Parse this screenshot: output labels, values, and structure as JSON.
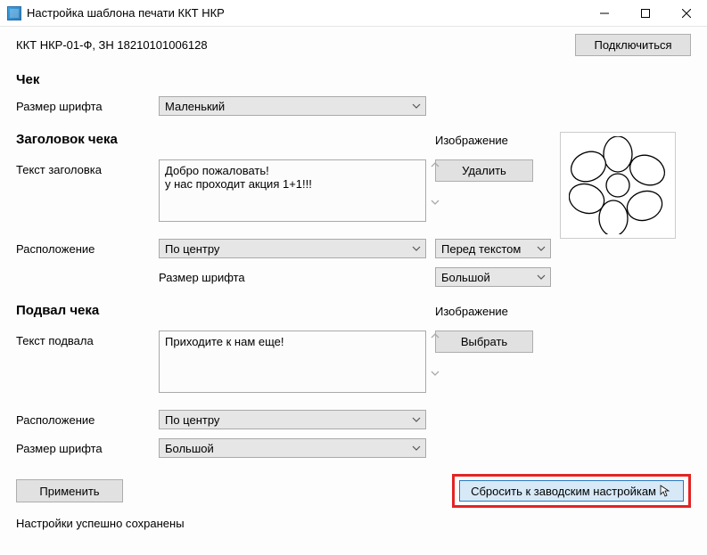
{
  "titlebar": {
    "title": "Настройка шаблона печати ККТ НКР"
  },
  "top": {
    "device_info": "ККТ НКР-01-Ф, ЗН 18210101006128",
    "connect_btn": "Подключиться"
  },
  "check": {
    "heading": "Чек",
    "font_label": "Размер шрифта",
    "font_value": "Маленький"
  },
  "header": {
    "heading": "Заголовок чека",
    "text_label": "Текст заголовка",
    "text_value": "Добро пожаловать!\nу нас проходит акция 1+1!!!",
    "image_label": "Изображение",
    "delete_btn": "Удалить",
    "position_label": "Расположение",
    "position_value": "По центру",
    "image_position_value": "Перед текстом",
    "font_label": "Размер шрифта",
    "font_value": "Большой"
  },
  "footer": {
    "heading": "Подвал чека",
    "text_label": "Текст подвала",
    "text_value": "Приходите к нам еще!",
    "image_label": "Изображение",
    "select_btn": "Выбрать",
    "position_label": "Расположение",
    "position_value": "По центру",
    "font_label": "Размер шрифта",
    "font_value": "Большой"
  },
  "actions": {
    "apply": "Применить",
    "reset": "Сбросить к заводским настройкам"
  },
  "status": "Настройки успешно сохранены"
}
